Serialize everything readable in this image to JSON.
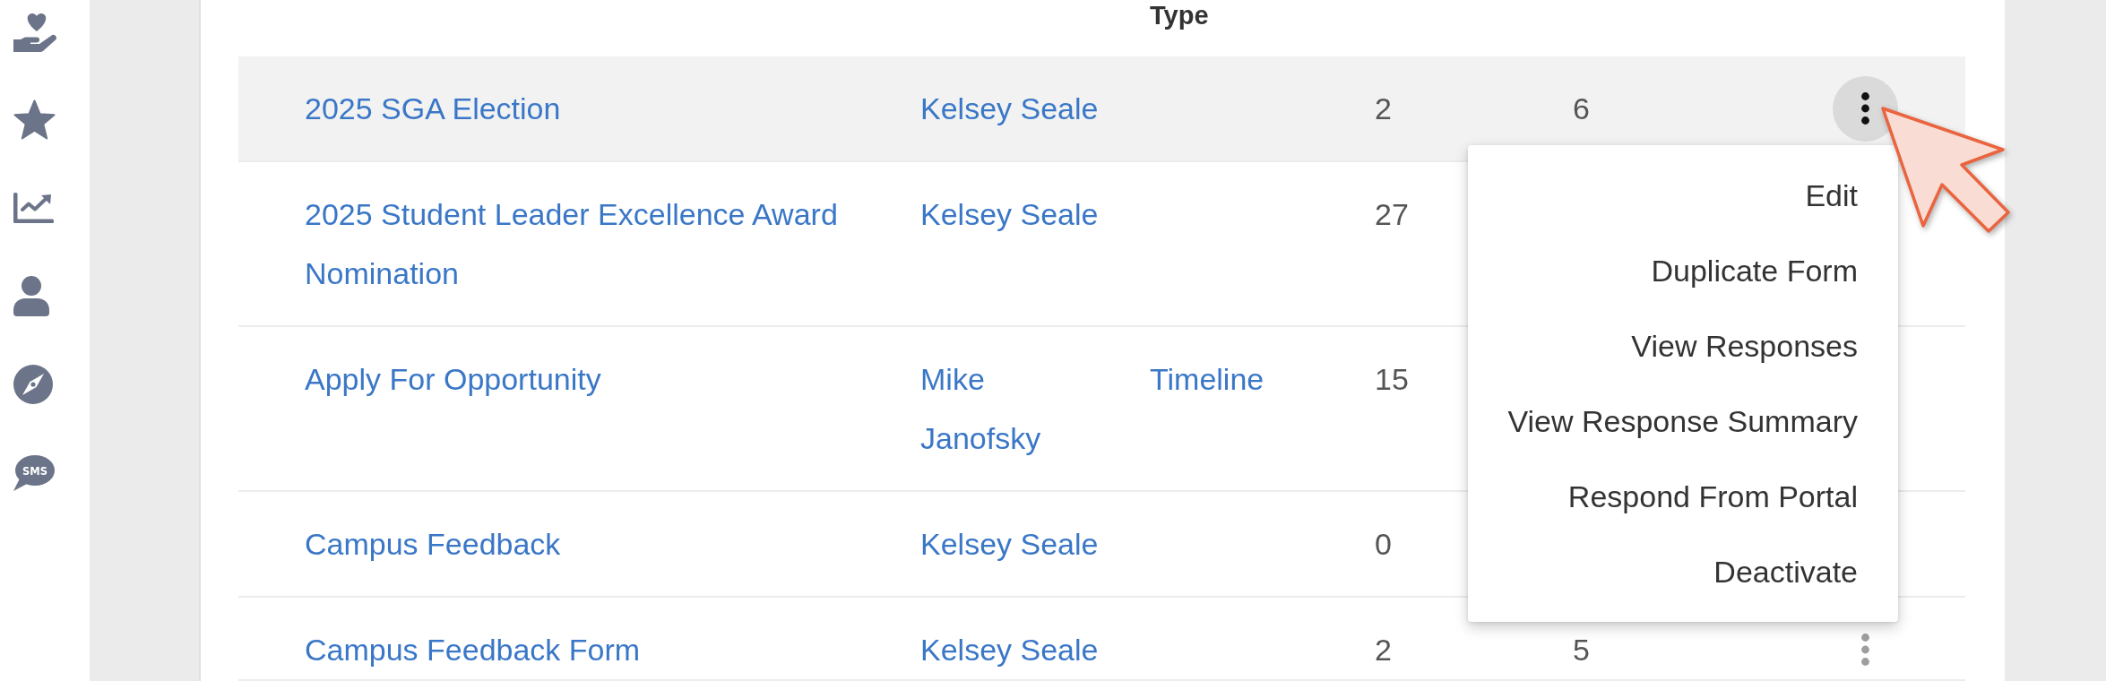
{
  "sidebar": {
    "sms_icon_text": "SMS"
  },
  "table": {
    "type_header": "Type",
    "rows": [
      {
        "column_1": "2025 SGA Election",
        "column_2": "Kelsey Seale",
        "column_4": "2",
        "column_5": "6",
        "highlighted": true,
        "menu": {
          "items": [
            "Edit",
            "Duplicate Form",
            "View Responses",
            "View Response Summary",
            "Respond From Portal",
            "Deactivate"
          ]
        }
      },
      {
        "column_1": "2025 Student Leader Excellence Award Nomination",
        "column_2": "Kelsey Seale",
        "column_4": "27",
        "highlighted": false
      },
      {
        "column_1": "Apply For Opportunity",
        "column_2": "Mike Janofsky",
        "type": "Timeline",
        "column_4": "15",
        "highlighted": false
      },
      {
        "column_1": "Campus Feedback",
        "column_2": "Kelsey Seale",
        "column_4": "0",
        "highlighted": false
      },
      {
        "column_1": "Campus Feedback Form",
        "column_2": "Kelsey Seale",
        "column_4": "2",
        "column_5": "5",
        "highlighted": false
      }
    ]
  }
}
